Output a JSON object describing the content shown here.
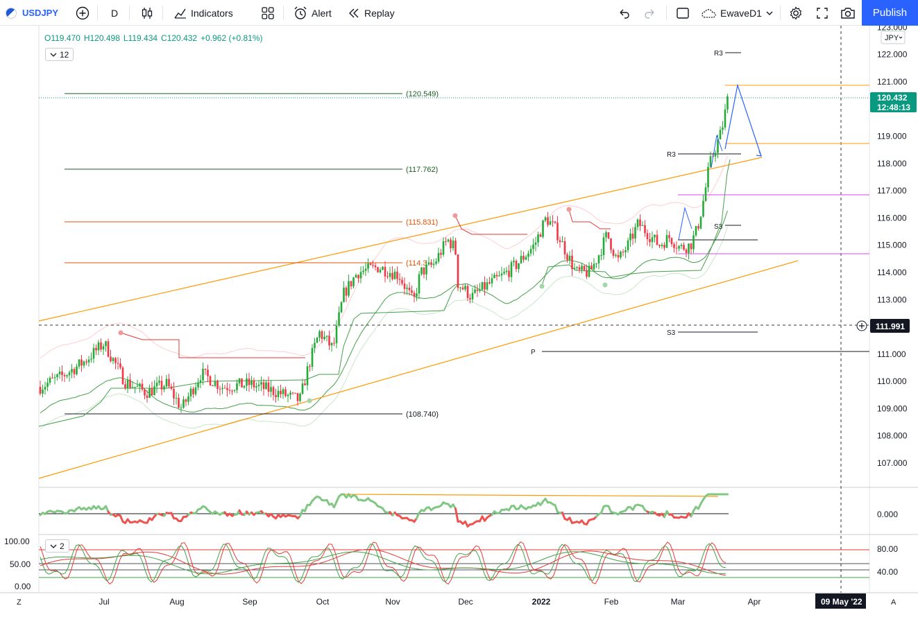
{
  "toolbar": {
    "symbol": "USDJPY",
    "interval": "D",
    "indicators_label": "Indicators",
    "alert_label": "Alert",
    "replay_label": "Replay",
    "layout_name": "EwaveD1",
    "publish_label": "Publish"
  },
  "legend": {
    "open": "O119.470",
    "high": "H120.498",
    "low": "L119.434",
    "close": "C120.432",
    "change": "+0.962 (+0.81%)",
    "indicator_count": "12",
    "pane_indicator_count": "2"
  },
  "price_axis": {
    "currency": "JPY",
    "ticks": [
      "123.000",
      "122.000",
      "121.000",
      "119.000",
      "118.000",
      "117.000",
      "116.000",
      "115.000",
      "114.000",
      "113.000",
      "111.000",
      "110.000",
      "109.000",
      "108.000",
      "107.000"
    ],
    "tick_values": [
      123,
      122,
      121,
      119,
      118,
      117,
      116,
      115,
      114,
      113,
      111,
      110,
      109,
      108,
      107
    ],
    "last_price": "120.432",
    "countdown": "12:48:13",
    "crosshair_price": "111.991",
    "osc1_tick": "0.000",
    "osc2_ticks": [
      "80.00",
      "40.00"
    ],
    "osc2_left_ticks": [
      "100.00",
      "50.00",
      "0.00"
    ]
  },
  "time_axis": {
    "labels": [
      "Jul",
      "Aug",
      "Sep",
      "Oct",
      "Nov",
      "Dec",
      "2022",
      "Feb",
      "Mar",
      "Apr"
    ],
    "crosshair_date": "09 May '22",
    "left_button": "Z",
    "right_button": "A"
  },
  "annotations": {
    "h_levels": [
      "(120.549)",
      "(117.762)",
      "(115.831)",
      "(114.3",
      "(108.740)"
    ],
    "pivots": [
      "R3",
      "R3",
      "S3",
      "S3",
      "P"
    ]
  },
  "colors": {
    "up": "#22ab36",
    "down": "#f23645",
    "channel": "#ff9800",
    "accent": "#2962ff",
    "pivot_line": "#131722",
    "magenta": "#e040fb"
  }
}
